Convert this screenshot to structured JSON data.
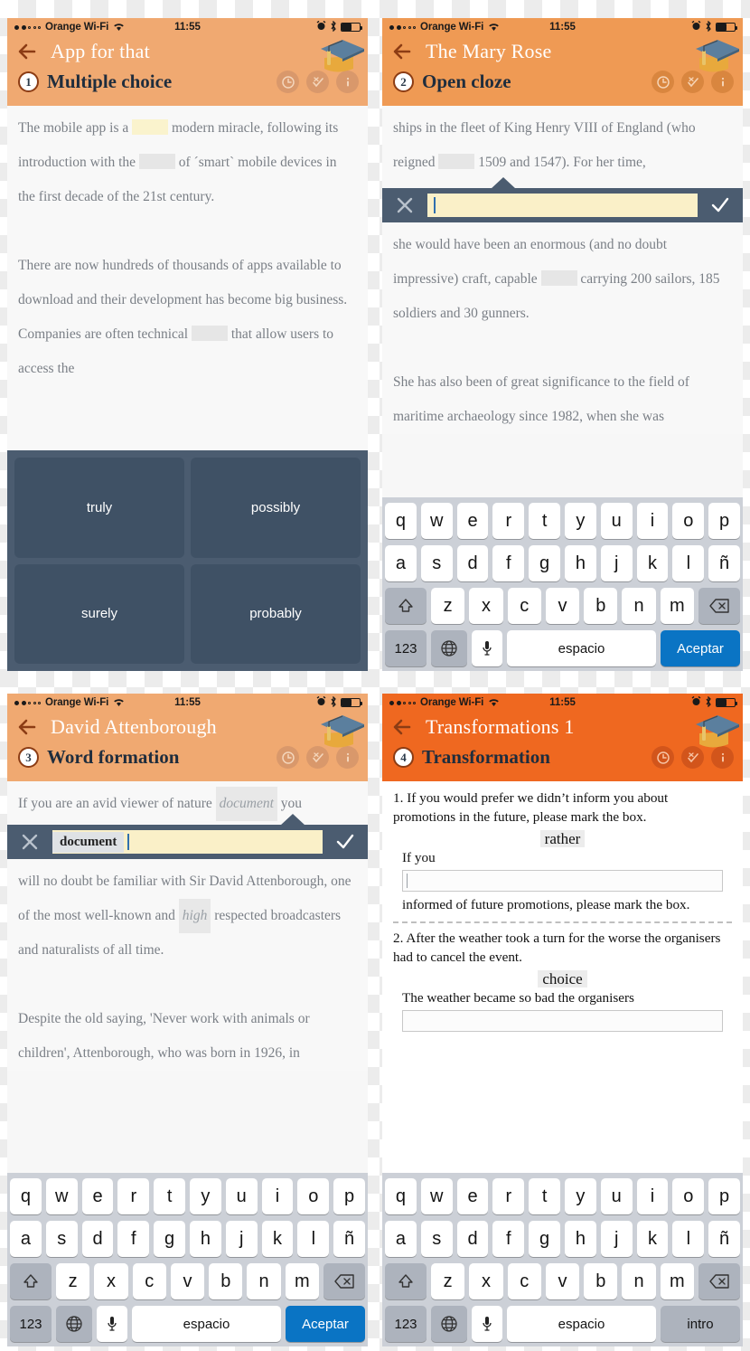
{
  "status_bar": {
    "carrier": "Orange Wi-Fi",
    "time": "11:55",
    "signal_filled": 2,
    "signal_empty": 3,
    "icons": [
      "alarm-icon",
      "bluetooth-icon",
      "battery-icon"
    ]
  },
  "keyboard": {
    "row1": [
      "q",
      "w",
      "e",
      "r",
      "t",
      "y",
      "u",
      "i",
      "o",
      "p"
    ],
    "row2": [
      "a",
      "s",
      "d",
      "f",
      "g",
      "h",
      "j",
      "k",
      "l",
      "ñ"
    ],
    "row3": [
      "z",
      "x",
      "c",
      "v",
      "b",
      "n",
      "m"
    ],
    "shift": "shift-icon",
    "backspace": "backspace-icon",
    "numbers": "123",
    "globe": "globe-icon",
    "mic": "microphone-icon",
    "space": "espacio",
    "enter_accept": "Aceptar",
    "enter_intro": "intro"
  },
  "panels": [
    {
      "id": "panel-multiple-choice",
      "nav_title": "App for that",
      "exercise_number": "1",
      "exercise_title": "Multiple choice",
      "header_color": "#f0a971",
      "icons": [
        "clock-icon",
        "check-x-icon",
        "info-icon"
      ],
      "paragraphs": [
        [
          {
            "t": "text",
            "v": "The mobile app is a "
          },
          {
            "t": "blank",
            "v": "yellow"
          },
          {
            "t": "text",
            "v": " modern miracle, following its introduction with the "
          },
          {
            "t": "blank",
            "v": "gray"
          },
          {
            "t": "text",
            "v": " of ´smart` mobile devices in the first decade of the 21st century."
          }
        ],
        [
          {
            "t": "text",
            "v": "There are now hundreds of thousands of apps available to download and their development has become big business. Companies are often technical "
          },
          {
            "t": "blank",
            "v": "gray"
          },
          {
            "t": "text",
            "v": " that allow users to access the"
          }
        ]
      ],
      "options": [
        "truly",
        "possibly",
        "surely",
        "probably"
      ]
    },
    {
      "id": "panel-open-cloze",
      "nav_title": "The Mary Rose",
      "exercise_number": "2",
      "exercise_title": "Open cloze",
      "header_color": "#ef9a54",
      "icons": [
        "clock-icon",
        "check-x-icon",
        "info-icon"
      ],
      "text_before": [
        {
          "t": "text",
          "v": "ships in the fleet of King Henry VIII of England (who reigned "
        },
        {
          "t": "blank",
          "v": "gray"
        },
        {
          "t": "text",
          "v": " 1509 and 1547). For her time,"
        }
      ],
      "answer_bar": {
        "prefix": "",
        "value": "",
        "close": "x-icon",
        "confirm": "check-icon"
      },
      "text_after": [
        [
          {
            "t": "text",
            "v": " she would have been an enormous (and no doubt impressive) craft, capable "
          },
          {
            "t": "blank",
            "v": "gray"
          },
          {
            "t": "text",
            "v": " carrying 200 sailors, 185 soldiers and 30 gunners."
          }
        ],
        [
          {
            "t": "text",
            "v": "She has also been of great significance to the field of maritime archaeology since 1982, when she was"
          }
        ]
      ],
      "enter_label": "Aceptar"
    },
    {
      "id": "panel-word-formation",
      "nav_title": "David Attenborough",
      "exercise_number": "3",
      "exercise_title": "Word formation",
      "header_color": "#f0a971",
      "icons": [
        "clock-icon",
        "check-x-icon",
        "info-icon"
      ],
      "text_before": [
        {
          "t": "text",
          "v": "If you are an avid viewer of nature "
        },
        {
          "t": "gapword",
          "v": "document"
        },
        {
          "t": "text",
          "v": " you"
        }
      ],
      "answer_bar": {
        "prefix": "document",
        "value": "",
        "close": "x-icon",
        "confirm": "check-icon"
      },
      "text_after": [
        [
          {
            "t": "text",
            "v": " will no doubt be familiar with Sir David Attenborough, one of the most well-known and "
          },
          {
            "t": "gapword",
            "v": "high"
          },
          {
            "t": "text",
            "v": " respected broadcasters and naturalists of all time."
          }
        ],
        [
          {
            "t": "text",
            "v": "Despite the old saying, 'Never work with animals or children', Attenborough, who was born in 1926, in"
          }
        ]
      ],
      "enter_label": "Aceptar"
    },
    {
      "id": "panel-transformation",
      "nav_title": "Transformations 1",
      "exercise_number": "4",
      "exercise_title": "Transformation",
      "header_color": "#ef6820",
      "icons": [
        "clock-icon",
        "check-x-icon",
        "info-icon"
      ],
      "items": [
        {
          "prompt": "1. If you would prefer we didn’t inform you about promotions in the future, please mark the box.",
          "keyword": "rather",
          "lead": "If you",
          "input_value": "",
          "tail": " informed of future promotions, please mark the box."
        },
        {
          "prompt": "2. After the weather took a turn for the worse the organisers had to cancel the event.",
          "keyword": "choice",
          "lead": "The weather became so bad the organisers",
          "input_value": "",
          "tail": ""
        }
      ],
      "enter_label": "intro"
    }
  ]
}
